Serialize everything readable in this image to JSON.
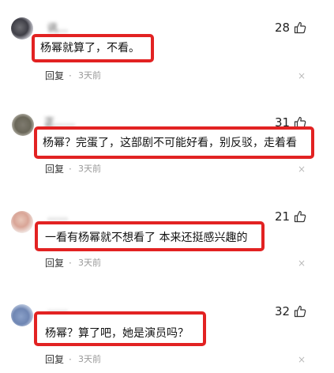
{
  "comments": [
    {
      "name": "讯…",
      "text": "杨幂就算了，不看。",
      "likes": "28",
      "reply_label": "回复",
      "dot": "·",
      "time": "3天前",
      "close": "×"
    },
    {
      "name": "正……",
      "text": "杨幂？完蛋了，这部剧不可能好看，别反驳，走着看",
      "likes": "31",
      "reply_label": "回复",
      "dot": "·",
      "time": "3天前",
      "close": "×"
    },
    {
      "name": "……",
      "text": "一看有杨幂就不想看了 本来还挺感兴趣的",
      "likes": "21",
      "reply_label": "回复",
      "dot": "·",
      "time": "3天前",
      "close": "×"
    },
    {
      "name": "……",
      "text": "杨幂？算了吧，她是演员吗？",
      "likes": "32",
      "reply_label": "回复",
      "dot": "·",
      "time": "3天前",
      "close": "×"
    }
  ],
  "colors": {
    "highlight_border": "#e22222",
    "muted_text": "#999999"
  },
  "icons": {
    "like": "thumbs-up-icon",
    "close": "close-icon"
  }
}
